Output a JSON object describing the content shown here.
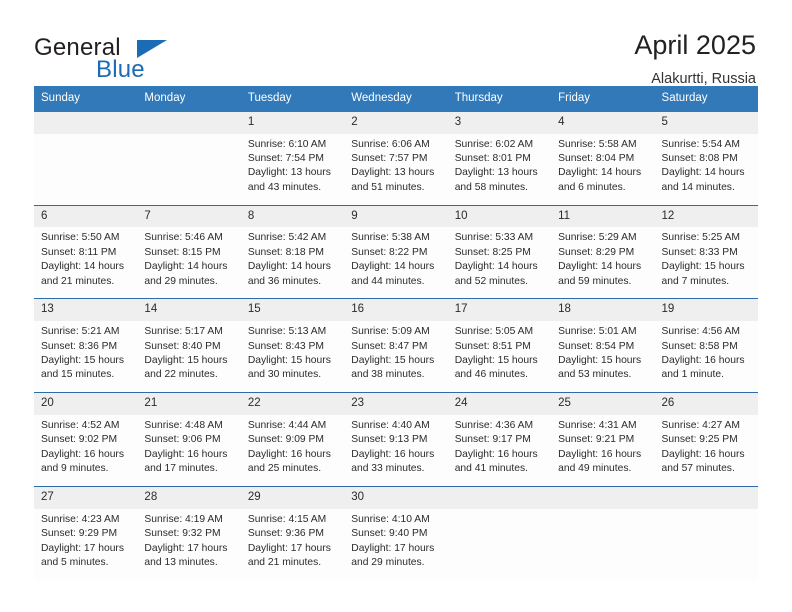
{
  "brand": {
    "word1": "General",
    "word2": "Blue",
    "flag_color": "#1b6cb5"
  },
  "header": {
    "title": "April 2025",
    "subtitle": "Alakurtti, Russia"
  },
  "theme": {
    "header_bg": "#3179b9",
    "row_divider": "#2c6cad",
    "date_band": "#efefef"
  },
  "weekdays": [
    "Sunday",
    "Monday",
    "Tuesday",
    "Wednesday",
    "Thursday",
    "Friday",
    "Saturday"
  ],
  "weeks": [
    [
      {
        "day": "",
        "lines": []
      },
      {
        "day": "",
        "lines": []
      },
      {
        "day": "1",
        "lines": [
          "Sunrise: 6:10 AM",
          "Sunset: 7:54 PM",
          "Daylight: 13 hours",
          "and 43 minutes."
        ]
      },
      {
        "day": "2",
        "lines": [
          "Sunrise: 6:06 AM",
          "Sunset: 7:57 PM",
          "Daylight: 13 hours",
          "and 51 minutes."
        ]
      },
      {
        "day": "3",
        "lines": [
          "Sunrise: 6:02 AM",
          "Sunset: 8:01 PM",
          "Daylight: 13 hours",
          "and 58 minutes."
        ]
      },
      {
        "day": "4",
        "lines": [
          "Sunrise: 5:58 AM",
          "Sunset: 8:04 PM",
          "Daylight: 14 hours",
          "and 6 minutes."
        ]
      },
      {
        "day": "5",
        "lines": [
          "Sunrise: 5:54 AM",
          "Sunset: 8:08 PM",
          "Daylight: 14 hours",
          "and 14 minutes."
        ]
      }
    ],
    [
      {
        "day": "6",
        "lines": [
          "Sunrise: 5:50 AM",
          "Sunset: 8:11 PM",
          "Daylight: 14 hours",
          "and 21 minutes."
        ]
      },
      {
        "day": "7",
        "lines": [
          "Sunrise: 5:46 AM",
          "Sunset: 8:15 PM",
          "Daylight: 14 hours",
          "and 29 minutes."
        ]
      },
      {
        "day": "8",
        "lines": [
          "Sunrise: 5:42 AM",
          "Sunset: 8:18 PM",
          "Daylight: 14 hours",
          "and 36 minutes."
        ]
      },
      {
        "day": "9",
        "lines": [
          "Sunrise: 5:38 AM",
          "Sunset: 8:22 PM",
          "Daylight: 14 hours",
          "and 44 minutes."
        ]
      },
      {
        "day": "10",
        "lines": [
          "Sunrise: 5:33 AM",
          "Sunset: 8:25 PM",
          "Daylight: 14 hours",
          "and 52 minutes."
        ]
      },
      {
        "day": "11",
        "lines": [
          "Sunrise: 5:29 AM",
          "Sunset: 8:29 PM",
          "Daylight: 14 hours",
          "and 59 minutes."
        ]
      },
      {
        "day": "12",
        "lines": [
          "Sunrise: 5:25 AM",
          "Sunset: 8:33 PM",
          "Daylight: 15 hours",
          "and 7 minutes."
        ]
      }
    ],
    [
      {
        "day": "13",
        "lines": [
          "Sunrise: 5:21 AM",
          "Sunset: 8:36 PM",
          "Daylight: 15 hours",
          "and 15 minutes."
        ]
      },
      {
        "day": "14",
        "lines": [
          "Sunrise: 5:17 AM",
          "Sunset: 8:40 PM",
          "Daylight: 15 hours",
          "and 22 minutes."
        ]
      },
      {
        "day": "15",
        "lines": [
          "Sunrise: 5:13 AM",
          "Sunset: 8:43 PM",
          "Daylight: 15 hours",
          "and 30 minutes."
        ]
      },
      {
        "day": "16",
        "lines": [
          "Sunrise: 5:09 AM",
          "Sunset: 8:47 PM",
          "Daylight: 15 hours",
          "and 38 minutes."
        ]
      },
      {
        "day": "17",
        "lines": [
          "Sunrise: 5:05 AM",
          "Sunset: 8:51 PM",
          "Daylight: 15 hours",
          "and 46 minutes."
        ]
      },
      {
        "day": "18",
        "lines": [
          "Sunrise: 5:01 AM",
          "Sunset: 8:54 PM",
          "Daylight: 15 hours",
          "and 53 minutes."
        ]
      },
      {
        "day": "19",
        "lines": [
          "Sunrise: 4:56 AM",
          "Sunset: 8:58 PM",
          "Daylight: 16 hours",
          "and 1 minute."
        ]
      }
    ],
    [
      {
        "day": "20",
        "lines": [
          "Sunrise: 4:52 AM",
          "Sunset: 9:02 PM",
          "Daylight: 16 hours",
          "and 9 minutes."
        ]
      },
      {
        "day": "21",
        "lines": [
          "Sunrise: 4:48 AM",
          "Sunset: 9:06 PM",
          "Daylight: 16 hours",
          "and 17 minutes."
        ]
      },
      {
        "day": "22",
        "lines": [
          "Sunrise: 4:44 AM",
          "Sunset: 9:09 PM",
          "Daylight: 16 hours",
          "and 25 minutes."
        ]
      },
      {
        "day": "23",
        "lines": [
          "Sunrise: 4:40 AM",
          "Sunset: 9:13 PM",
          "Daylight: 16 hours",
          "and 33 minutes."
        ]
      },
      {
        "day": "24",
        "lines": [
          "Sunrise: 4:36 AM",
          "Sunset: 9:17 PM",
          "Daylight: 16 hours",
          "and 41 minutes."
        ]
      },
      {
        "day": "25",
        "lines": [
          "Sunrise: 4:31 AM",
          "Sunset: 9:21 PM",
          "Daylight: 16 hours",
          "and 49 minutes."
        ]
      },
      {
        "day": "26",
        "lines": [
          "Sunrise: 4:27 AM",
          "Sunset: 9:25 PM",
          "Daylight: 16 hours",
          "and 57 minutes."
        ]
      }
    ],
    [
      {
        "day": "27",
        "lines": [
          "Sunrise: 4:23 AM",
          "Sunset: 9:29 PM",
          "Daylight: 17 hours",
          "and 5 minutes."
        ]
      },
      {
        "day": "28",
        "lines": [
          "Sunrise: 4:19 AM",
          "Sunset: 9:32 PM",
          "Daylight: 17 hours",
          "and 13 minutes."
        ]
      },
      {
        "day": "29",
        "lines": [
          "Sunrise: 4:15 AM",
          "Sunset: 9:36 PM",
          "Daylight: 17 hours",
          "and 21 minutes."
        ]
      },
      {
        "day": "30",
        "lines": [
          "Sunrise: 4:10 AM",
          "Sunset: 9:40 PM",
          "Daylight: 17 hours",
          "and 29 minutes."
        ]
      },
      {
        "day": "",
        "lines": []
      },
      {
        "day": "",
        "lines": []
      },
      {
        "day": "",
        "lines": []
      }
    ]
  ]
}
